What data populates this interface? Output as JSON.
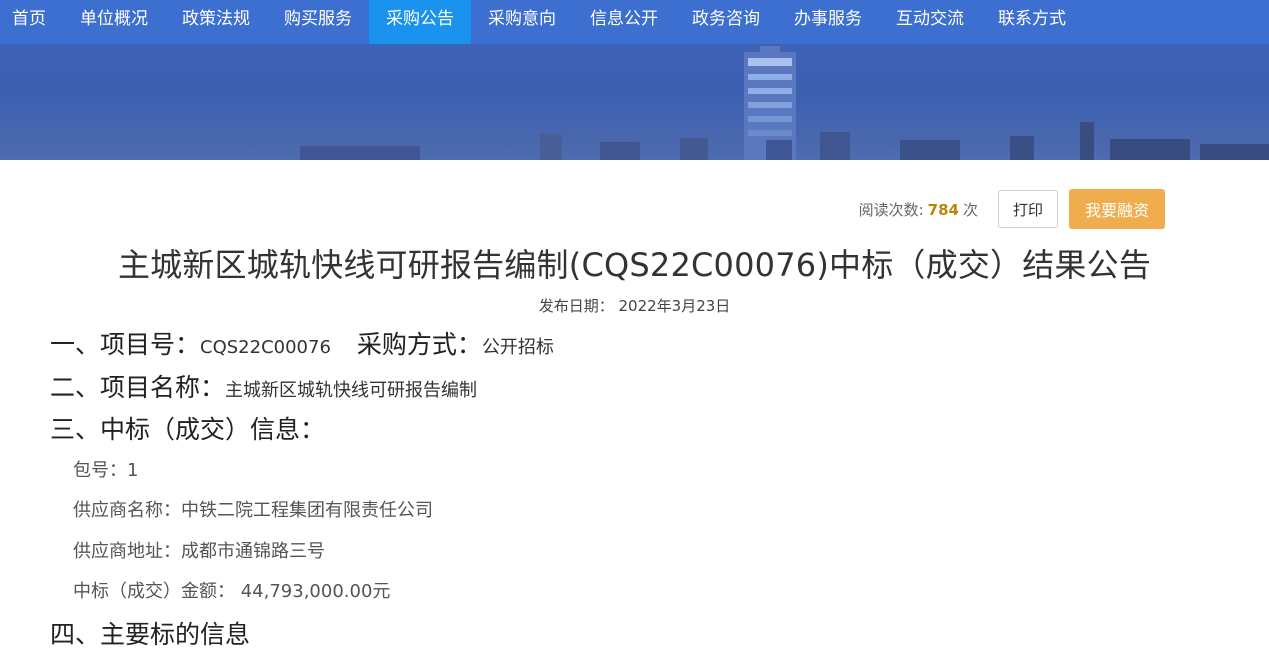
{
  "nav": {
    "items": [
      {
        "label": "首页"
      },
      {
        "label": "单位概况"
      },
      {
        "label": "政策法规"
      },
      {
        "label": "购买服务"
      },
      {
        "label": "采购公告"
      },
      {
        "label": "采购意向"
      },
      {
        "label": "信息公开"
      },
      {
        "label": "政务咨询"
      },
      {
        "label": "办事服务"
      },
      {
        "label": "互动交流"
      },
      {
        "label": "联系方式"
      }
    ],
    "active_index": 4,
    "bg_color": "#3c6fcf",
    "active_color": "#1a93ee"
  },
  "toolbar": {
    "views_label": "阅读次数:",
    "views_count": "784",
    "views_unit": "次",
    "print_label": "打印",
    "finance_label": "我要融资",
    "finance_color": "#f0ad4e"
  },
  "article": {
    "title": "主城新区城轨快线可研报告编制(CQS22C00076)中标（成交）结果公告",
    "pub_date_label": "发布日期：",
    "pub_date": "2022年3月23日",
    "sec1_label": "一、项目号：",
    "sec1_value": "CQS22C00076",
    "sec1b_label": "采购方式：",
    "sec1b_value": "公开招标",
    "sec2_label": "二、项目名称：",
    "sec2_value": "主城新区城轨快线可研报告编制",
    "sec3_label": "三、中标（成交）信息：",
    "package_label": "包号：",
    "package_value": "1",
    "supplier_name_label": "供应商名称：",
    "supplier_name_value": "中铁二院工程集团有限责任公司",
    "supplier_addr_label": "供应商地址：",
    "supplier_addr_value": "成都市通锦路三号",
    "amount_label": "中标（成交）金额：",
    "amount_value": " 44,793,000.00元",
    "sec4_label": "四、主要标的信息"
  }
}
